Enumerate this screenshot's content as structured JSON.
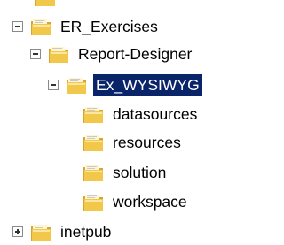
{
  "tree": {
    "items": [
      {
        "label": "ER_Exercises",
        "state": "expanded"
      },
      {
        "label": "Report-Designer",
        "state": "expanded"
      },
      {
        "label": "Ex_WYSIWYG",
        "state": "expanded-selected"
      },
      {
        "label": "datasources"
      },
      {
        "label": "resources"
      },
      {
        "label": "solution"
      },
      {
        "label": "workspace"
      },
      {
        "label": "inetpub",
        "state": "collapsed"
      }
    ],
    "selection_color": "#0a246a",
    "folder_color": "#f2c84a"
  }
}
